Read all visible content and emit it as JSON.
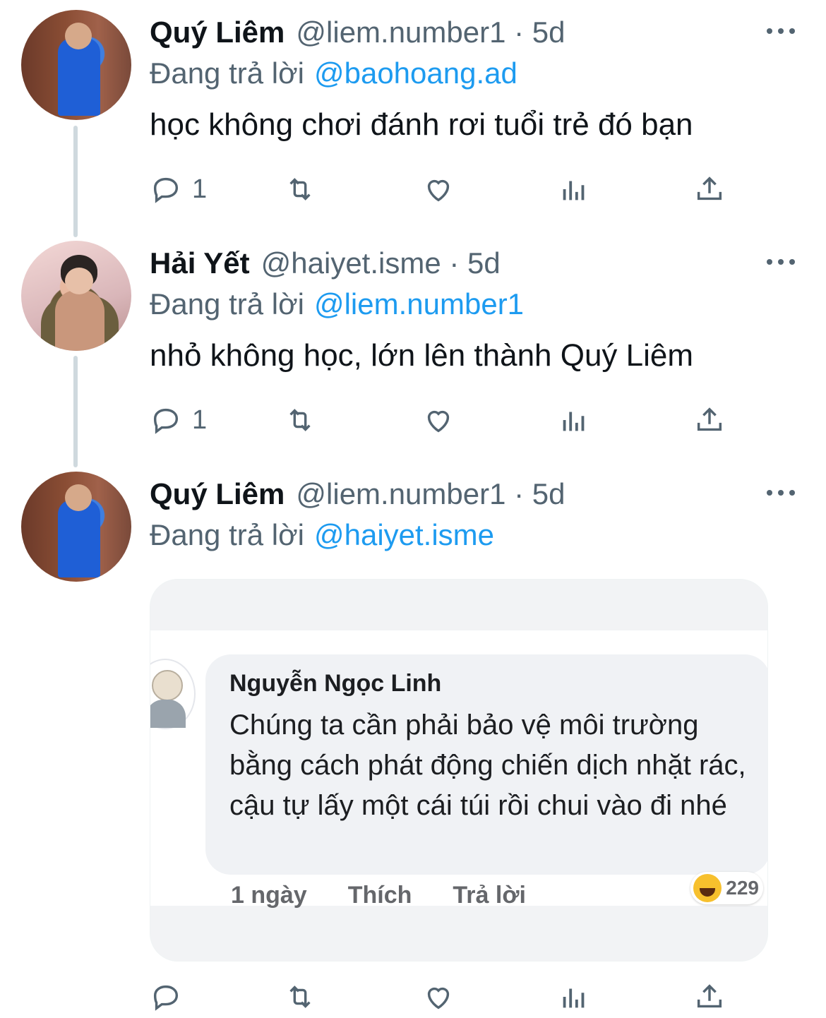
{
  "tweets": [
    {
      "name": "Quý Liêm",
      "handle": "@liem.number1 · 5d",
      "replying_prefix": "Đang trả lời",
      "replying_to": "@baohoang.ad",
      "text": "học không chơi đánh rơi tuổi trẻ đó bạn",
      "reply_count": "1"
    },
    {
      "name": "Hải Yết",
      "handle": "@haiyet.isme · 5d",
      "replying_prefix": "Đang trả lời",
      "replying_to": "@liem.number1",
      "text": "nhỏ không học, lớn lên thành Quý Liêm",
      "reply_count": "1"
    },
    {
      "name": "Quý Liêm",
      "handle": "@liem.number1 · 5d",
      "replying_prefix": "Đang trả lời",
      "replying_to": "@haiyet.isme",
      "reply_count": ""
    }
  ],
  "embedded_comment": {
    "author": "Nguyễn Ngọc Linh",
    "text": "Chúng ta cần phải bảo vệ môi trường bằng cách phát động chiến dịch nhặt rác, cậu tự lấy một cái túi rồi chui vào đi nhé",
    "time": "1 ngày",
    "like_label": "Thích",
    "reply_label": "Trả lời",
    "reaction_count": "229",
    "reaction_icon": "haha-emoji-icon"
  },
  "colors": {
    "link": "#1d9bf0",
    "secondary_text": "#536471",
    "thread_line": "#cfd9de"
  }
}
